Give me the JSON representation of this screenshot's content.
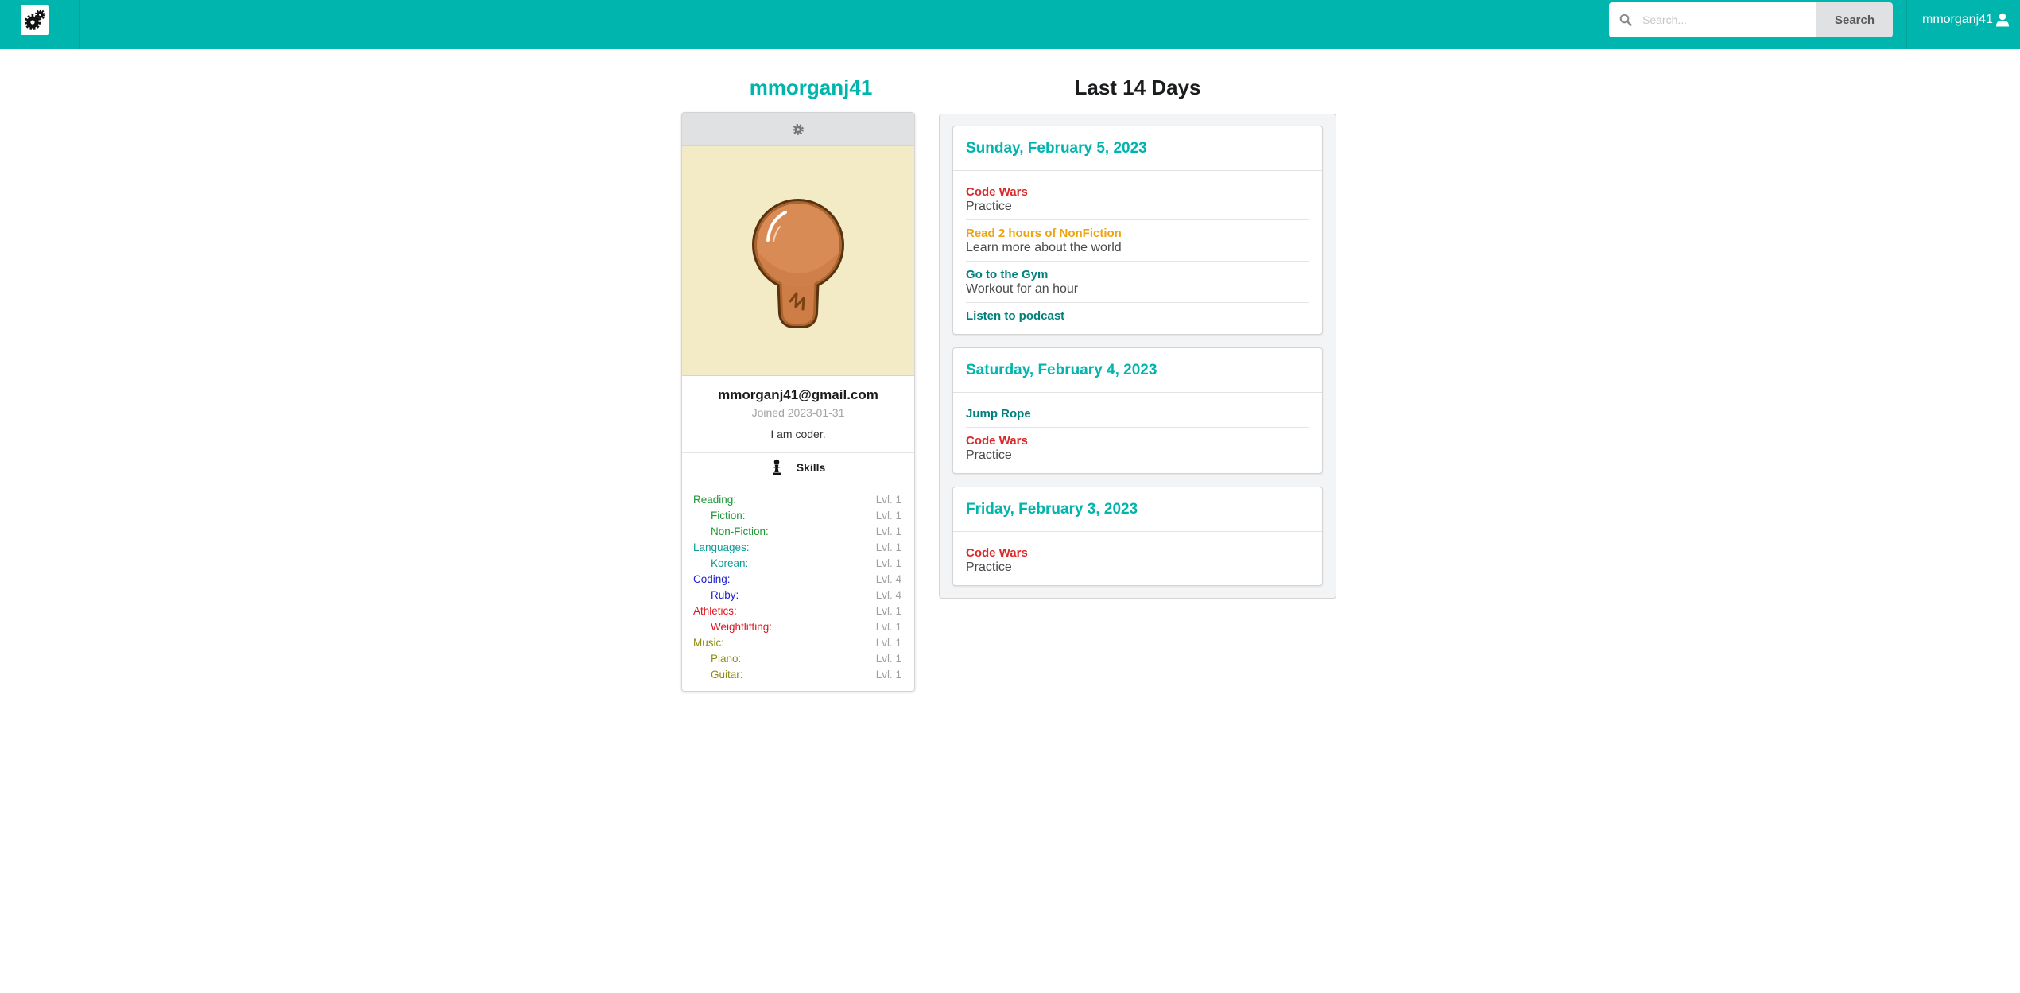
{
  "nav": {
    "logo_icon": "gears-icon",
    "search_icon": "search-icon",
    "search_placeholder": "Search...",
    "search_button": "Search",
    "username": "mmorganj41",
    "user_icon": "user-icon"
  },
  "colors": {
    "brand": "#00b5ad",
    "panel_background": "#f3f4f5",
    "avatar_background": "#f3ebc6"
  },
  "profile": {
    "username": "mmorganj41",
    "settings_icon": "gear-icon",
    "avatar_icon": "lightbulb-icon",
    "email": "mmorganj41@gmail.com",
    "joined": "Joined 2023-01-31",
    "bio": "I am coder.",
    "skills_icon": "pawn-icon",
    "skills_label": "Skills",
    "skills": [
      {
        "name": "Reading:",
        "level": "Lvl. 1",
        "color": "#1d9633",
        "subskills": [
          {
            "name": "Fiction:",
            "level": "Lvl. 1"
          },
          {
            "name": "Non-Fiction:",
            "level": "Lvl. 1"
          }
        ]
      },
      {
        "name": "Languages:",
        "level": "Lvl. 1",
        "color": "#0e9a98",
        "subskills": [
          {
            "name": "Korean:",
            "level": "Lvl. 1"
          }
        ]
      },
      {
        "name": "Coding:",
        "level": "Lvl. 4",
        "color": "#1c1cd2",
        "subskills": [
          {
            "name": "Ruby:",
            "level": "Lvl. 4"
          }
        ]
      },
      {
        "name": "Athletics:",
        "level": "Lvl. 1",
        "color": "#e0161f",
        "subskills": [
          {
            "name": "Weightlifting:",
            "level": "Lvl. 1"
          }
        ]
      },
      {
        "name": "Music:",
        "level": "Lvl. 1",
        "color": "#8c8c10",
        "subskills": [
          {
            "name": "Piano:",
            "level": "Lvl. 1"
          },
          {
            "name": "Guitar:",
            "level": "Lvl. 1"
          }
        ]
      }
    ]
  },
  "activity": {
    "title": "Last 14 Days",
    "days": [
      {
        "date": "Sunday, February 5, 2023",
        "tasks": [
          {
            "name": "Code Wars",
            "description": "Practice",
            "color": "#db2828"
          },
          {
            "name": "Read 2 hours of NonFiction",
            "description": "Learn more about the world",
            "color": "#efa30f"
          },
          {
            "name": "Go to the Gym",
            "description": "Workout for an hour",
            "color": "#00807c"
          },
          {
            "name": "Listen to podcast",
            "color": "#00807c"
          }
        ]
      },
      {
        "date": "Saturday, February 4, 2023",
        "tasks": [
          {
            "name": "Jump Rope",
            "color": "#00807c"
          },
          {
            "name": "Code Wars",
            "description": "Practice",
            "color": "#db2828"
          }
        ]
      },
      {
        "date": "Friday, February 3, 2023",
        "tasks": [
          {
            "name": "Code Wars",
            "description": "Practice",
            "color": "#db2828"
          }
        ]
      }
    ]
  }
}
